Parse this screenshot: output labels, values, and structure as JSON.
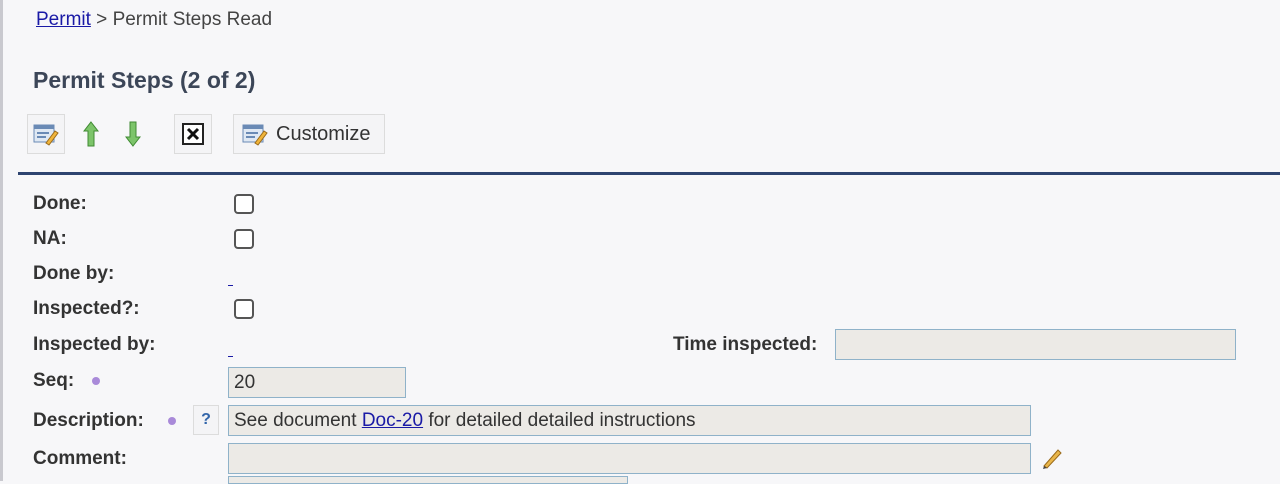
{
  "breadcrumb": {
    "link": "Permit",
    "separator": " > ",
    "current": "Permit Steps Read"
  },
  "title": "Permit Steps (2 of 2)",
  "toolbar": {
    "edit_icon": "edit-form-icon",
    "up_icon": "arrow-up-icon",
    "down_icon": "arrow-down-icon",
    "delete_icon": "close-box-icon",
    "customize_label": "Customize"
  },
  "form": {
    "done_label": "Done:",
    "done_checked": false,
    "na_label": "NA:",
    "na_checked": false,
    "done_by_label": "Done by:",
    "inspected_label": "Inspected?:",
    "inspected_checked": false,
    "inspected_by_label": "Inspected by:",
    "time_inspected_label": "Time inspected:",
    "time_inspected_value": "",
    "seq_label": "Seq:",
    "seq_value": "20",
    "description_label": "Description:",
    "description_help": "?",
    "description_prefix": "See document ",
    "description_link": "Doc-20",
    "description_suffix": " for detailed detailed instructions",
    "comment_label": "Comment:",
    "comment_value": ""
  },
  "colors": {
    "accent_rule": "#2e4470",
    "link": "#1a1aa6",
    "required_dot": "#a98ad9",
    "field_border": "#8fb2c9",
    "field_bg": "#eceae6"
  }
}
